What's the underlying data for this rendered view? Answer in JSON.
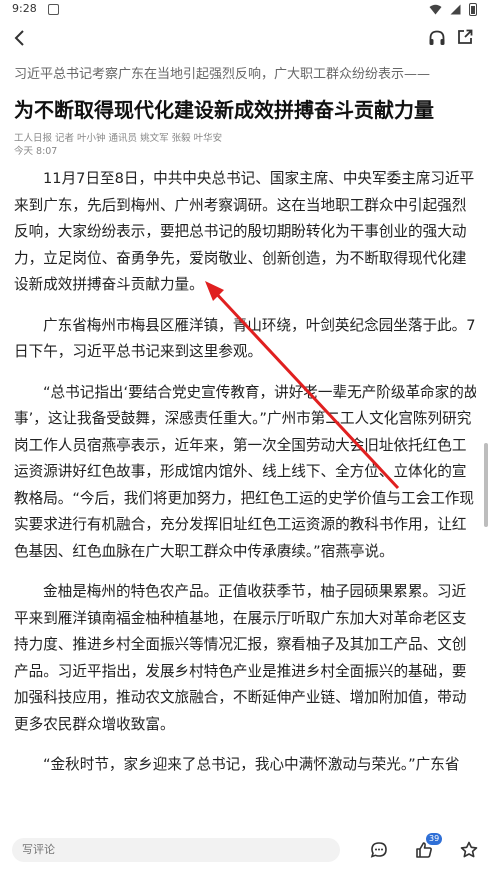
{
  "status_bar": {
    "time": "9:28",
    "icons": [
      "notification-icon",
      "wifi-icon",
      "cell-signal-icon",
      "battery-icon"
    ]
  },
  "top_nav": {
    "icons": [
      "back-arrow-icon",
      "headphones-icon",
      "share-icon"
    ]
  },
  "article": {
    "subhead": "习近平总书记考察广东在当地引起强烈反响，广大职工群众纷纷表示——",
    "title": "为不断取得现代化建设新成效拼搏奋斗贡献力量",
    "byline": "工人日报 记者 叶小钟 通讯员 姚文军 张毅 叶华安",
    "date": "今天 8:07",
    "paragraphs": [
      {
        "lines": [
          "11月7日至8日，中共中央总书记、国家主席、中央军委主席习近平",
          "来到广东，先后到梅州、广州考察调研。这在当地职工群众中引起强烈",
          "反响，大家纷纷表示，要把总书记的殷切期盼转化为干事创业的强大动",
          "力，立足岗位、奋勇争先，爱岗敬业、创新创造，为不断取得现代化建",
          "设新成效拼搏奋斗贡献力量。"
        ]
      },
      {
        "lines": [
          "广东省梅州市梅县区雁洋镇，青山环绕，叶剑英纪念园坐落于此。7",
          "日下午，习近平总书记来到这里参观。"
        ]
      },
      {
        "lines": [
          "“总书记指出‘要结合党史宣传教育，讲好老一辈无产阶级革命家的故",
          "事’，这让我备受鼓舞，深感责任重大。”广州市第二工人文化宫陈列研究",
          "岗工作人员宿燕亭表示，近年来，第一次全国劳动大会旧址依托红色工",
          "运资源讲好红色故事，形成馆内馆外、线上线下、全方位、立体化的宣",
          "教格局。“今后，我们将更加努力，把红色工运的史学价值与工会工作现",
          "实要求进行有机融合，充分发挥旧址红色工运资源的教科书作用，让红",
          "色基因、红色血脉在广大职工群众中传承赓续。”宿燕亭说。"
        ]
      },
      {
        "lines": [
          "金柚是梅州的特色农产品。正值收获季节，柚子园硕果累累。习近",
          "平来到雁洋镇南福金柚种植基地，在展示厅听取广东加大对革命老区支",
          "持力度、推进乡村全面振兴等情况汇报，察看柚子及其加工产品、文创",
          "产品。习近平指出，发展乡村特色产业是推进乡村全面振兴的基础，要",
          "加强科技应用，推动农文旅融合，不断延伸产业链、增加附加值，带动",
          "更多农民群众增收致富。"
        ]
      },
      {
        "lines": [
          "“金秋时节，家乡迎来了总书记，我心中满怀激动与荣光。”广东省"
        ]
      }
    ]
  },
  "annotation": {
    "color": "#e02020"
  },
  "bottom_bar": {
    "comment_placeholder": "写评论",
    "like_count": "39",
    "icons": [
      "comment-icon",
      "thumbs-up-icon",
      "star-icon"
    ]
  }
}
